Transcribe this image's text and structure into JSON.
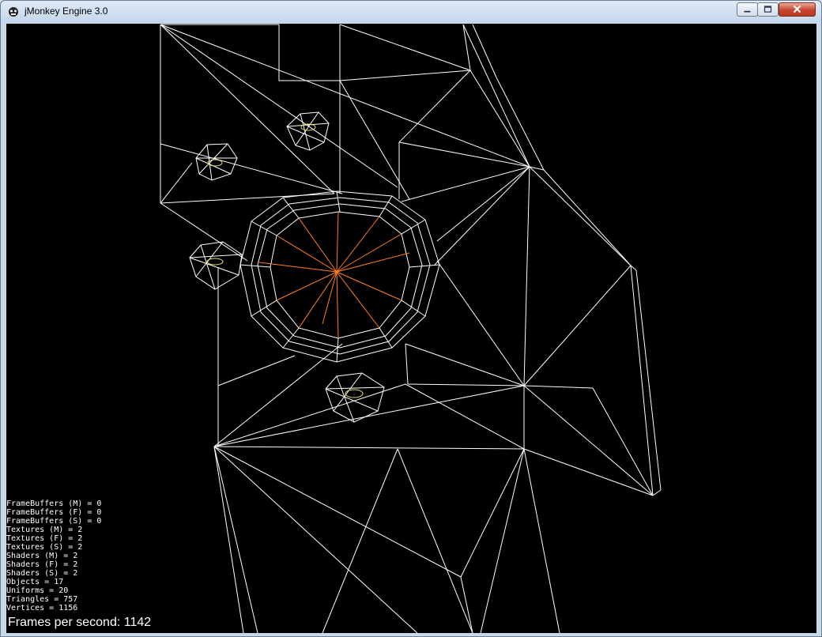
{
  "window": {
    "title": "jMonkey Engine 3.0",
    "icon": "jmonkey-app-icon",
    "controls": [
      "minimize-icon",
      "maximize-icon",
      "close-icon"
    ]
  },
  "colors": {
    "background": "#000000",
    "wireframe": "#ffffff",
    "highlight": "#ff8020",
    "marker": "#e8e070"
  },
  "stats": [
    "FrameBuffers (M) = 0",
    "FrameBuffers (F) = 0",
    "FrameBuffers (S) = 0",
    "Textures (M) = 2",
    "Textures (F) = 2",
    "Textures (S) = 2",
    "Shaders (M) = 2",
    "Shaders (F) = 2",
    "Shaders (S) = 2",
    "Objects = 17",
    "Uniforms = 20",
    "Triangles = 757",
    "Vertices = 1156"
  ],
  "fps": "Frames per second: 1142"
}
